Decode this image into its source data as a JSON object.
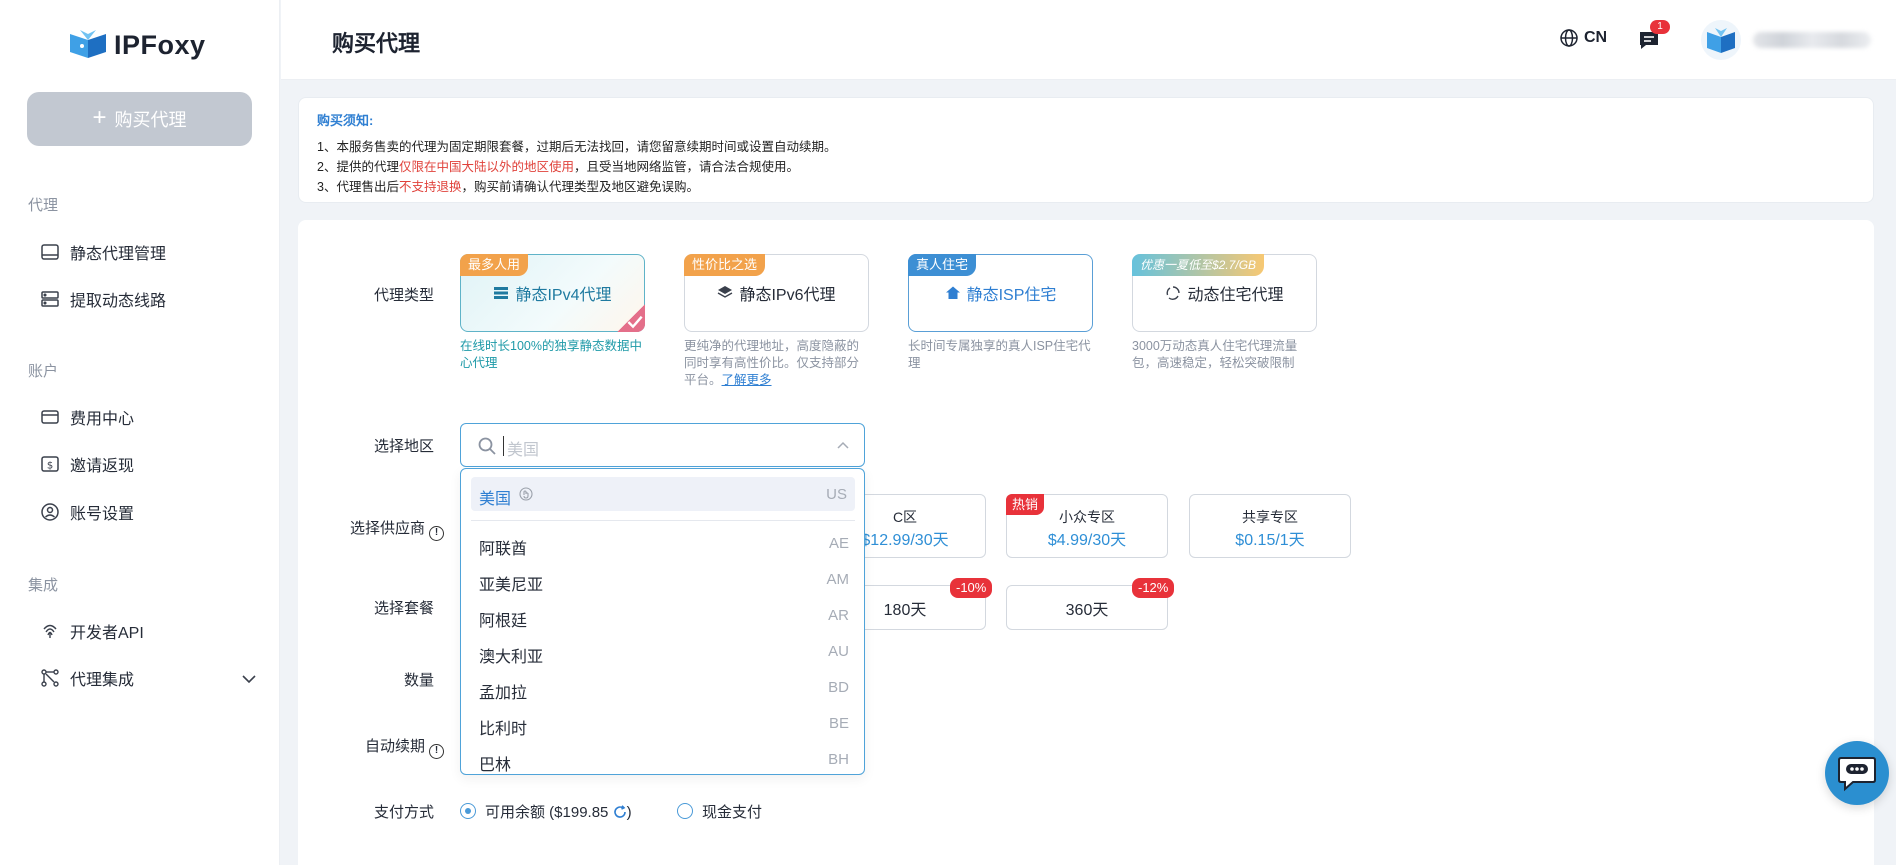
{
  "app": {
    "logo_text": "IPFoxy"
  },
  "sidebar": {
    "buy_button": "购买代理",
    "sections": [
      {
        "title": "代理",
        "items": [
          {
            "label": "静态代理管理",
            "icon": "monitor-icon"
          },
          {
            "label": "提取动态线路",
            "icon": "server-icon"
          }
        ]
      },
      {
        "title": "账户",
        "items": [
          {
            "label": "费用中心",
            "icon": "card-icon"
          },
          {
            "label": "邀请返现",
            "icon": "dollar-icon"
          },
          {
            "label": "账号设置",
            "icon": "user-circle-icon"
          }
        ]
      },
      {
        "title": "集成",
        "items": [
          {
            "label": "开发者API",
            "icon": "fingerprint-icon"
          },
          {
            "label": "代理集成",
            "icon": "integration-icon"
          }
        ]
      }
    ]
  },
  "header": {
    "title": "购买代理",
    "lang": "CN",
    "msg_count": "1"
  },
  "notice": {
    "title": "购买须知:",
    "line1": "1、本服务售卖的代理为固定期限套餐，过期后无法找回，请您留意续期时间或设置自动续期。",
    "line2_pre": "2、提供的代理",
    "line2_red": "仅限在中国大陆以外的地区使用",
    "line2_post": "，且受当地网络监管，请合法合规使用。",
    "line3_pre": "3、代理售出后",
    "line3_red": "不支持退换",
    "line3_post": "，购买前请确认代理类型及地区避免误购。"
  },
  "labels": {
    "proxy_type": "代理类型",
    "region": "选择地区",
    "provider": "选择供应商",
    "plan": "选择套餐",
    "quantity": "数量",
    "auto_renew": "自动续期",
    "payment": "支付方式"
  },
  "proxy_types": [
    {
      "tag": "最多人用",
      "name": "静态IPv4代理",
      "desc": "在线时长100%的独享静态数据中心代理"
    },
    {
      "tag": "性价比之选",
      "name": "静态IPv6代理",
      "desc": "更纯净的代理地址，高度隐蔽的同时享有高性价比。仅支持部分平台。",
      "link": "了解更多"
    },
    {
      "tag": "真人住宅",
      "name": "静态ISP住宅",
      "desc": "长时间专属独享的真人ISP住宅代理"
    },
    {
      "tag": "优惠一夏低至$2.7/GB",
      "name": "动态住宅代理",
      "desc": "3000万动态真人住宅代理流量包，高速稳定，轻松突破限制"
    }
  ],
  "region": {
    "placeholder": "美国",
    "selected": {
      "name": "美国",
      "code": "US"
    },
    "options": [
      {
        "name": "阿联酋",
        "code": "AE"
      },
      {
        "name": "亚美尼亚",
        "code": "AM"
      },
      {
        "name": "阿根廷",
        "code": "AR"
      },
      {
        "name": "澳大利亚",
        "code": "AU"
      },
      {
        "name": "孟加拉",
        "code": "BD"
      },
      {
        "name": "比利时",
        "code": "BE"
      },
      {
        "name": "巴林",
        "code": "BH"
      }
    ]
  },
  "zones": [
    {
      "name": "C区",
      "price": "$12.99/30天"
    },
    {
      "name": "小众专区",
      "price": "$4.99/30天",
      "tag": "热销"
    },
    {
      "name": "共享专区",
      "price": "$0.15/1天"
    }
  ],
  "plans": [
    {
      "label": "180天",
      "discount": "-10%"
    },
    {
      "label": "360天",
      "discount": "-12%"
    }
  ],
  "payment": {
    "balance_label": "可用余额 ($199.85",
    "balance_close": ")",
    "cash_label": "现金支付"
  },
  "colors": {
    "accent": "#2f7fd2",
    "red": "#e8323a",
    "teal": "#1f9aa8"
  }
}
